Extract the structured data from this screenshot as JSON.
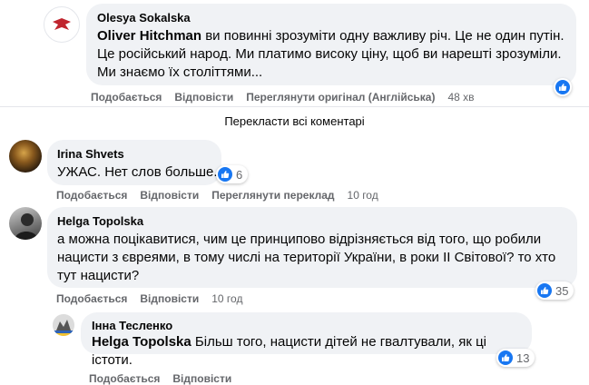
{
  "comments": [
    {
      "author": "Olesya Sokalska",
      "mention": "Oliver Hitchman",
      "lines": [
        " ви повинні зрозуміти одну важливу річ. Це не один путін.",
        "Це російський народ. Ми платимо високу ціну, щоб ви нарешті зрозуміли.",
        "Ми знаємо їх століттями..."
      ],
      "actions": {
        "like": "Подобається",
        "reply": "Відповісти",
        "extra": "Переглянути оригінал (Англійська)",
        "time": "48 хв"
      },
      "reaction": {
        "icon": "like-icon",
        "count": ""
      }
    },
    {
      "author": "Irina Shvets",
      "mention": "",
      "lines": [
        "УЖАС. Нет слов больше."
      ],
      "actions": {
        "like": "Подобається",
        "reply": "Відповісти",
        "extra": "Переглянути переклад",
        "time": "10 год"
      },
      "reaction": {
        "icon": "like-icon",
        "count": "6"
      }
    },
    {
      "author": "Helga Topolska",
      "mention": "",
      "lines": [
        "а можна поцікавитися, чим це принципово відрізняється від того, що робили",
        "нацисти з євреями, в тому числі на території України, в роки ІІ Світової? то хто",
        "тут нацисти?"
      ],
      "actions": {
        "like": "Подобається",
        "reply": "Відповісти",
        "extra": "",
        "time": "10 год"
      },
      "reaction": {
        "icon": "like-icon",
        "count": "35"
      }
    },
    {
      "author": "Інна Тесленко",
      "mention": "Helga Topolska",
      "lines": [
        " Більш того, нацисти дітей не гвалтували, як ці істоти."
      ],
      "actions": {
        "like": "Подобається",
        "reply": "Відповісти",
        "extra": "",
        "time": ""
      },
      "reaction": {
        "icon": "like-icon",
        "count": "13"
      }
    }
  ],
  "translate_all": "Перекласти всі коментарі",
  "colors": {
    "like_blue": "#1877f2",
    "bubble": "#f0f2f5",
    "meta": "#65676b"
  }
}
